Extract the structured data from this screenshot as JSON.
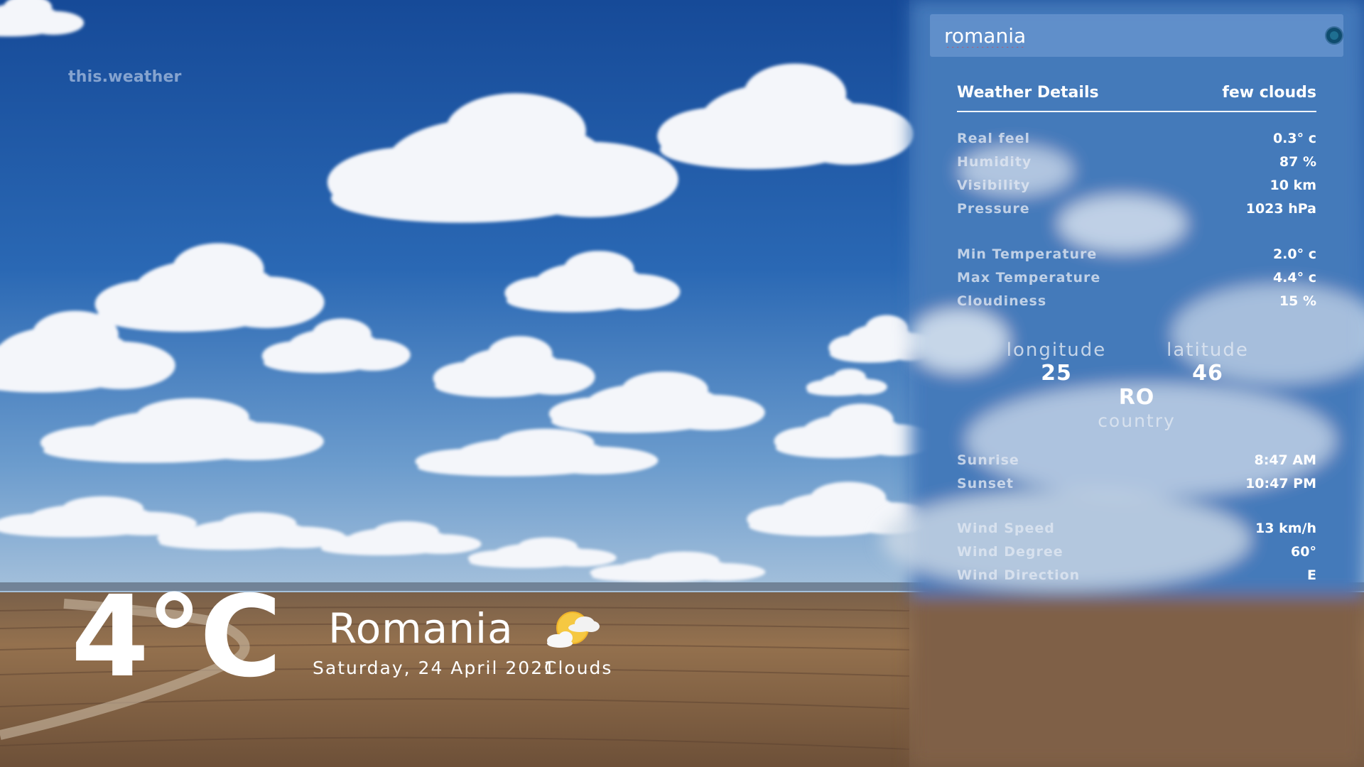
{
  "app": {
    "brand": "this.weather"
  },
  "current": {
    "temperature": "4°C",
    "location": "Romania",
    "date": "Saturday, 24 April 2021",
    "condition": "Clouds",
    "condition_icon": "sun-behind-clouds-icon"
  },
  "search": {
    "value": "romania",
    "button_icon": "search-dot-icon"
  },
  "details": {
    "title": "Weather Details",
    "description": "few clouds",
    "group1": [
      {
        "label": "Real feel",
        "value": "0.3° c"
      },
      {
        "label": "Humidity",
        "value": "87 %"
      },
      {
        "label": "Visibility",
        "value": "10 km"
      },
      {
        "label": "Pressure",
        "value": "1023 hPa"
      }
    ],
    "group2": [
      {
        "label": "Min Temperature",
        "value": "2.0° c"
      },
      {
        "label": "Max Temperature",
        "value": "4.4° c"
      },
      {
        "label": "Cloudiness",
        "value": "15 %"
      }
    ],
    "coords": {
      "longitude_label": "longitude",
      "longitude": "25",
      "latitude_label": "latitude",
      "latitude": "46",
      "country_code": "RO",
      "country_label": "country"
    },
    "group3": [
      {
        "label": "Sunrise",
        "value": "8:47 AM"
      },
      {
        "label": "Sunset",
        "value": "10:47 PM"
      }
    ],
    "group4": [
      {
        "label": "Wind Speed",
        "value": "13 km/h"
      },
      {
        "label": "Wind Degree",
        "value": "60°"
      },
      {
        "label": "Wind Direction",
        "value": "E"
      }
    ]
  },
  "colors": {
    "sky_top": "#1a4f9c",
    "sky_horizon": "#8fb4d8",
    "field": "#8a6a4a",
    "search_bg": "#5f87c4",
    "sun": "#f5c842"
  }
}
